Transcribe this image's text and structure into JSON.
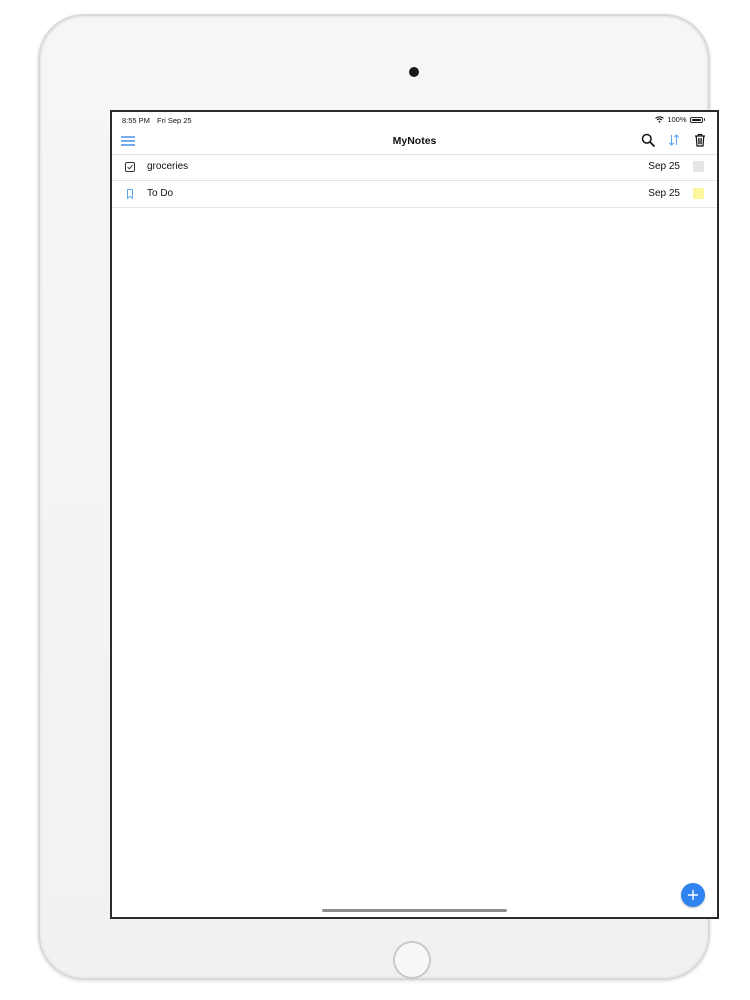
{
  "status_bar": {
    "time": "8:55 PM",
    "date": "Fri Sep 25",
    "battery": "100%",
    "battery_level": 1.0
  },
  "nav": {
    "title": "MyNotes",
    "left_icon": "menu-icon",
    "right_icons": [
      "search-icon",
      "sort-icon",
      "trash-icon"
    ]
  },
  "notes": [
    {
      "title": "groceries",
      "date": "Sep 25",
      "icon": "checklist-icon",
      "color": "#e6e6e8"
    },
    {
      "title": "To Do",
      "date": "Sep 25",
      "icon": "bookmark-icon",
      "color": "#fdf79b"
    }
  ],
  "fab": {
    "icon": "add-icon"
  },
  "colors": {
    "accent": "#2f83f0",
    "sort_icon": "#5fa6f2",
    "menu_icon": "#2f7fe0"
  }
}
